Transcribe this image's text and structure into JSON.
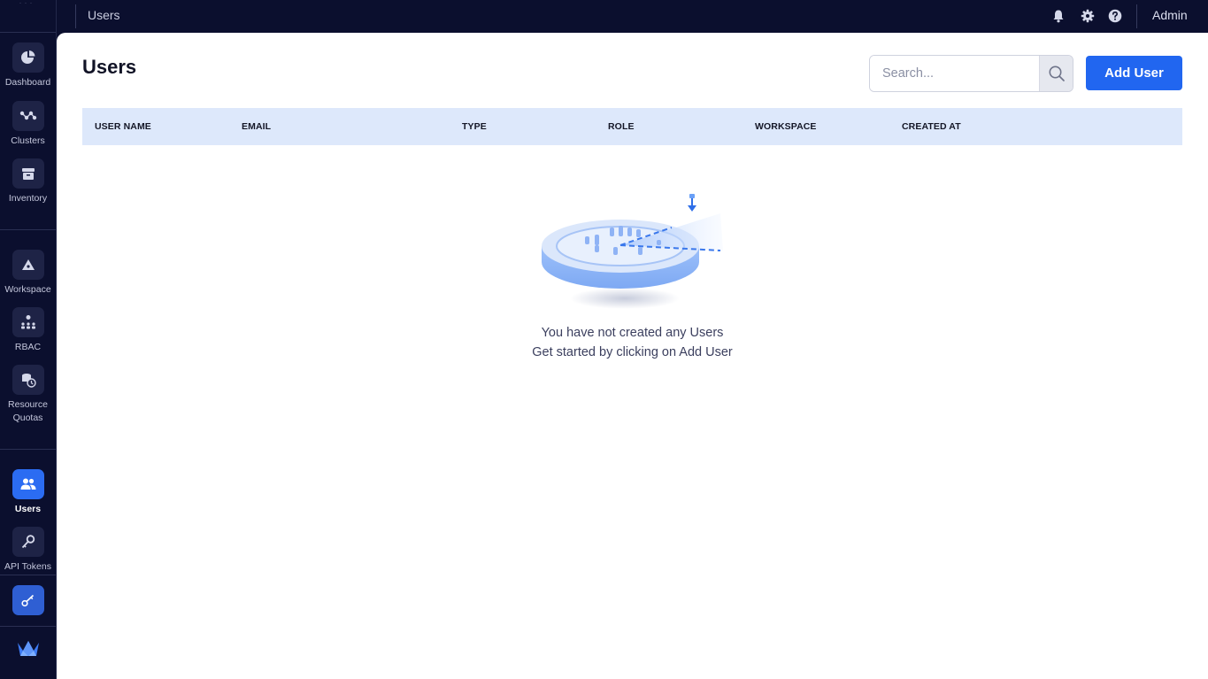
{
  "sidebar": {
    "items": [
      {
        "label": "Dashboard",
        "icon": "pie-chart-icon"
      },
      {
        "label": "Clusters",
        "icon": "cluster-nodes-icon"
      },
      {
        "label": "Inventory",
        "icon": "archive-box-icon"
      },
      {
        "label": "Workspace",
        "icon": "workspace-icon"
      },
      {
        "label": "RBAC",
        "icon": "rbac-people-icon"
      },
      {
        "label": "Resource Quotas",
        "icon": "resource-quota-icon"
      },
      {
        "label": "Users",
        "icon": "users-icon",
        "active": true
      },
      {
        "label": "API Tokens",
        "icon": "key-icon"
      }
    ]
  },
  "topbar": {
    "breadcrumb": "Users",
    "user": "Admin"
  },
  "main": {
    "title": "Users",
    "search_placeholder": "Search...",
    "add_button": "Add User",
    "columns": [
      "USER NAME",
      "EMAIL",
      "TYPE",
      "ROLE",
      "WORKSPACE",
      "CREATED AT"
    ],
    "empty_line1": "You have not created any Users",
    "empty_line2": "Get started by clicking on Add User"
  },
  "colors": {
    "sidebar_bg": "#0b0f2e",
    "accent": "#2166f0",
    "table_header_bg": "#dde8fb"
  }
}
